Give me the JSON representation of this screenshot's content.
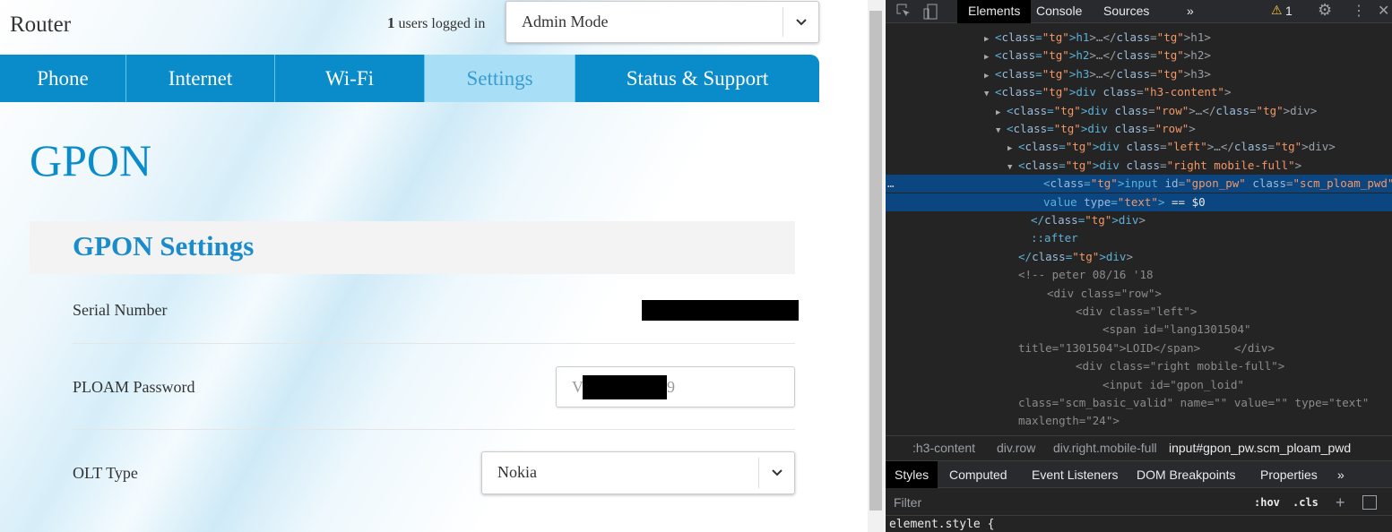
{
  "header": {
    "brand": "Router",
    "users_count": "1",
    "users_text": "users logged in",
    "mode": "Admin Mode"
  },
  "nav": [
    {
      "label": "Phone"
    },
    {
      "label": "Internet"
    },
    {
      "label": "Wi-Fi"
    },
    {
      "label": "Settings",
      "active": true
    },
    {
      "label": "Status & Support"
    }
  ],
  "page": {
    "title": "GPON",
    "section": "GPON Settings",
    "fields": {
      "serial_label": "Serial Number",
      "ploam_label": "PLOAM Password",
      "ploam_prefix": "V",
      "ploam_suffix": "9",
      "olt_label": "OLT Type",
      "olt_value": "Nokia"
    }
  },
  "colors": {
    "brand_blue": "#0a8ccb",
    "active_tab": "#a9dff6",
    "devtools_bg": "#242424",
    "selection": "#0b4680"
  },
  "devtools": {
    "tabs": [
      "Elements",
      "Console",
      "Sources",
      "»"
    ],
    "warnings": "1",
    "tree": [
      "<h1>…</h1>",
      "<h2>…</h2>",
      "<h3>…</h3>",
      "<div class=\"h3-content\">",
      "<div class=\"row\">…</div>",
      "<div class=\"row\">",
      "<div class=\"left\">…</div>",
      "<div class=\"right mobile-full\">",
      "<input id=\"gpon_pw\" class=\"scm_ploam_pwd\" name",
      "value type=\"text\"> == $0",
      "</div>",
      "::after",
      "</div>",
      "<!-- peter 08/16 '18",
      "<div class=\"row\">",
      "<div class=\"left\">",
      "<span id=\"lang1301504\"",
      "title=\"1301504\">LOID</span>     </div>",
      "<div class=\"right mobile-full\">",
      "<input id=\"gpon_loid\"",
      "class=\"scm_basic_valid\" name=\"\" value=\"\" type=\"text\"",
      "maxlength=\"24\">",
      "</div>"
    ],
    "breadcrumbs": [
      ":h3-content",
      "div.row",
      "div.right.mobile-full",
      "input#gpon_pw.scm_ploam_pwd"
    ],
    "styles_tabs": [
      "Styles",
      "Computed",
      "Event Listeners",
      "DOM Breakpoints",
      "Properties",
      "»"
    ],
    "filter_placeholder": "Filter",
    "hov": ":hov",
    "cls": ".cls",
    "element_style": "element.style {"
  }
}
